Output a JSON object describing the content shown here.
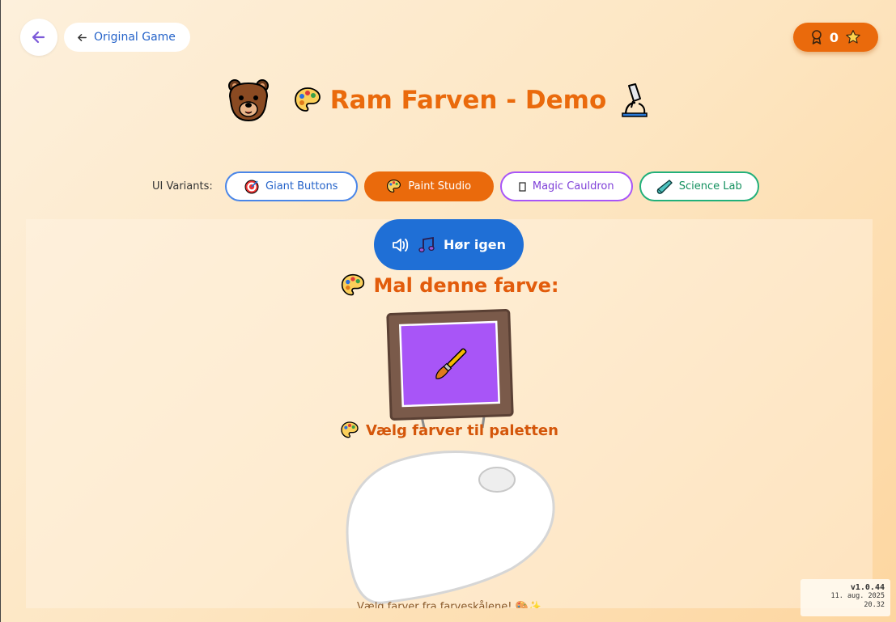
{
  "header": {
    "back_icon": "arrow-left-icon",
    "original_game_label": "Original Game",
    "score_value": "0",
    "score_icons": [
      "award-icon",
      "star-icon"
    ]
  },
  "title": {
    "text": "Ram Farven - Demo",
    "icons": [
      "bear-icon",
      "palette-icon",
      "microscope-icon"
    ]
  },
  "variants": {
    "label": "UI Variants:",
    "items": [
      {
        "label": "Giant Buttons",
        "icon": "target-icon",
        "selected": false
      },
      {
        "label": "Paint Studio",
        "icon": "palette-icon",
        "selected": true
      },
      {
        "label": "Magic Cauldron",
        "icon": "unknown-glyph-icon",
        "selected": false
      },
      {
        "label": "Science Lab",
        "icon": "test-tube-icon",
        "selected": false
      }
    ]
  },
  "game": {
    "listen_label": "Hør igen",
    "paint_heading": "Mal denne farve:",
    "target_color": "#a855f7",
    "palette_label": "Vælg farver til paletten",
    "bottom_hint": "Vælg farver fra farveskålene! 🎨✨"
  },
  "version": {
    "number": "v1.0.44",
    "date": "11. aug. 2025",
    "time": "20.32"
  },
  "colors": {
    "accent": "#ea6a0c",
    "primary_blue": "#1f6fd6"
  }
}
